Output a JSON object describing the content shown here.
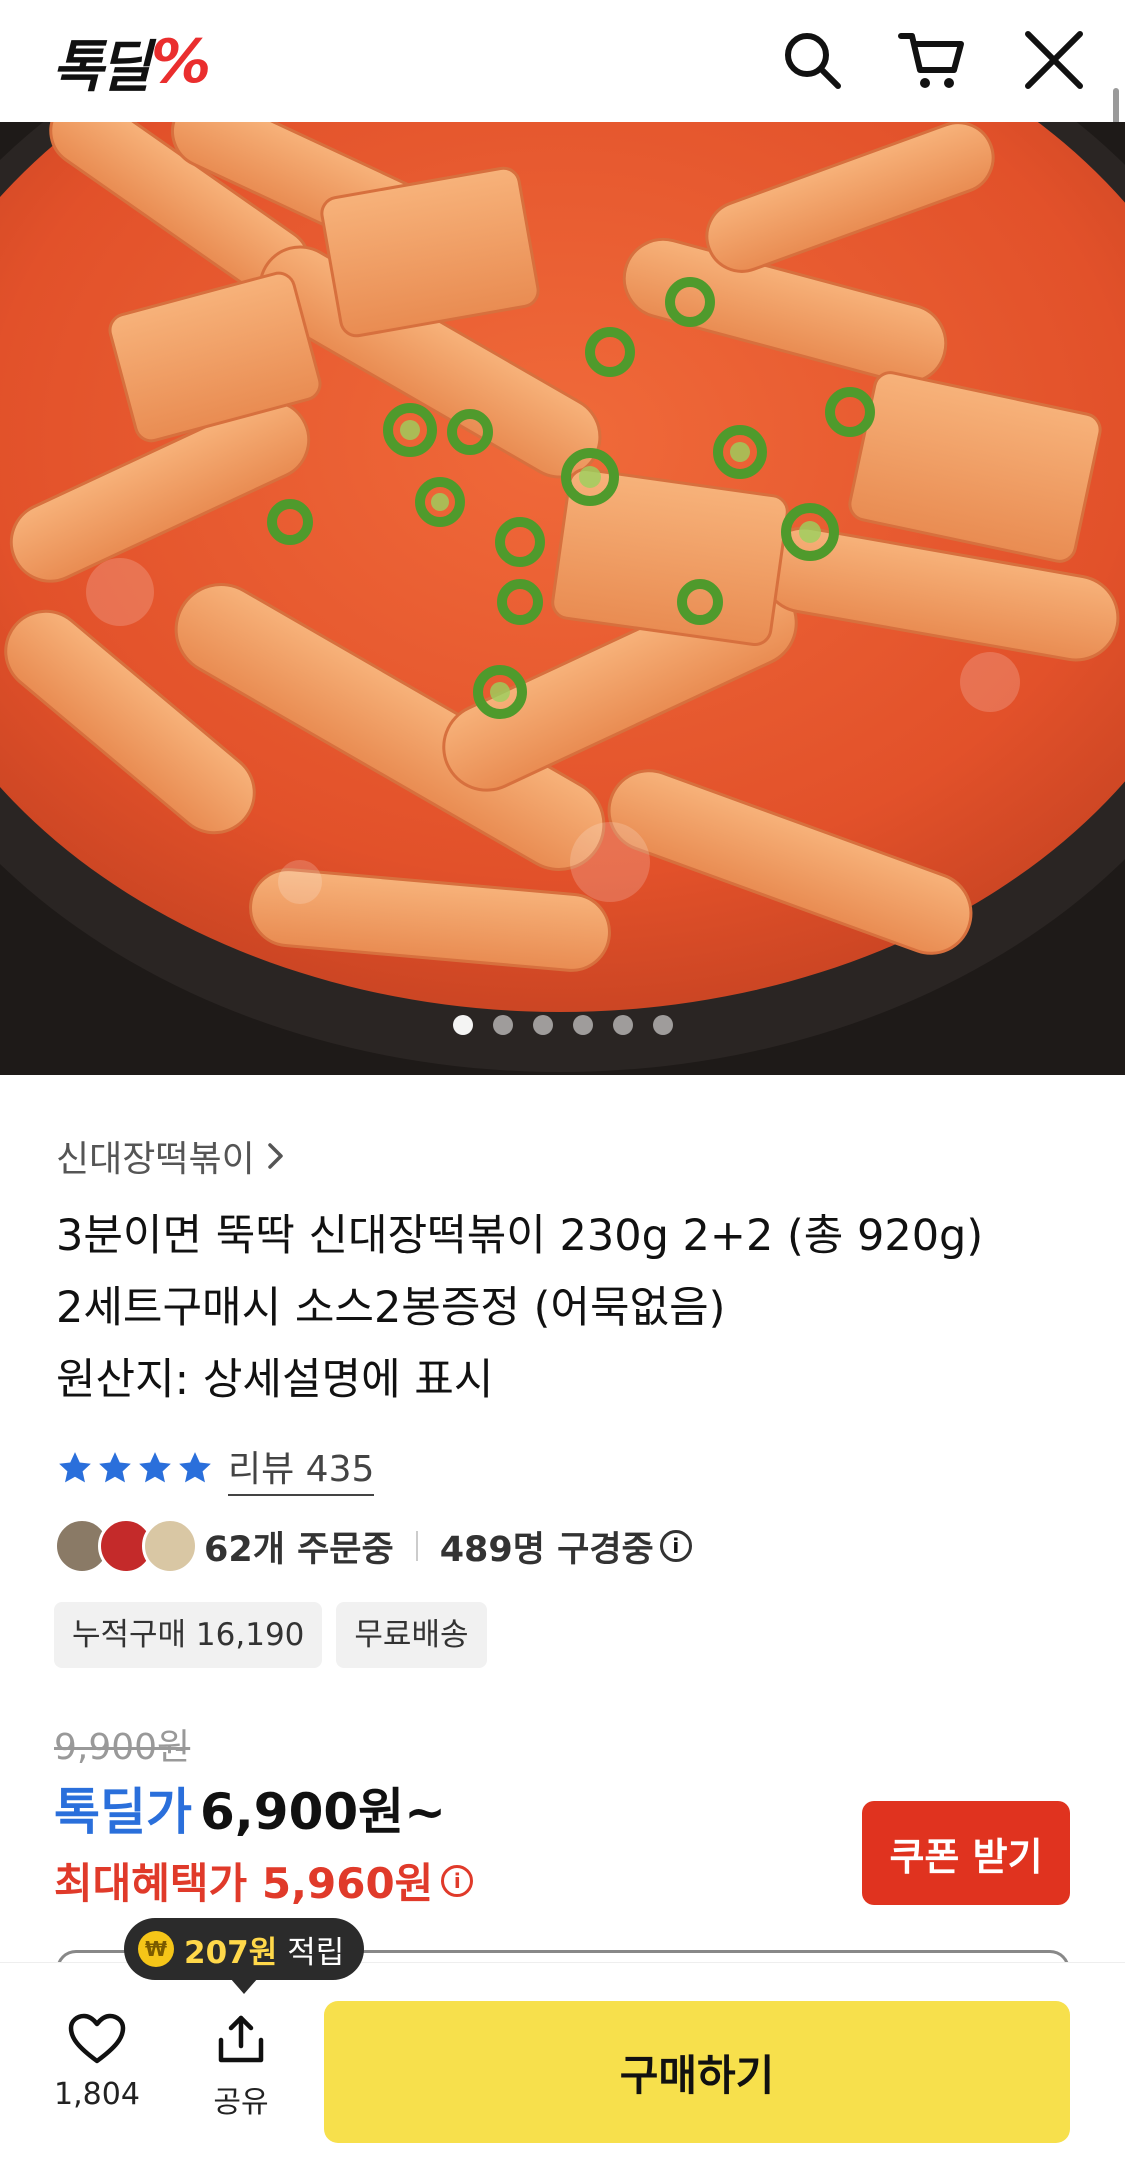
{
  "header": {
    "logo_text": "톡딜",
    "logo_mark": "%",
    "icons": [
      "search-icon",
      "cart-icon",
      "close-icon"
    ]
  },
  "hero": {
    "dot_count": 6,
    "active_dot": 1
  },
  "product": {
    "category_link": "신대장떡볶이",
    "title_lines": [
      "3분이면 뚝딱 신대장떡볶이 230g 2+2 (총 920g)",
      "2세트구매시 소스2봉증정 (어묵없음)",
      "원산지: 상세설명에 표시"
    ],
    "rating_stars": 4,
    "review_label": "리뷰 435",
    "ordering": "62개 주문중",
    "watching": "489명 구경중",
    "chips": [
      "누적구매 16,190",
      "무료배송"
    ]
  },
  "price": {
    "original": "9,900원",
    "deal_label": "톡딜가",
    "deal_price": "6,900원~",
    "max_benefit": "최대혜택가 5,960원",
    "coupon_button": "쿠폰 받기"
  },
  "bottom": {
    "like_count": "1,804",
    "share_label": "공유",
    "buy_button": "구매하기",
    "points_amount": "207원",
    "points_suffix": "적립",
    "coin_glyph": "₩"
  },
  "colors": {
    "accent_blue": "#2a6fdb",
    "accent_red": "#e03a2a",
    "buy_yellow": "#f7e04c",
    "logo_red": "#ea2e2e"
  }
}
